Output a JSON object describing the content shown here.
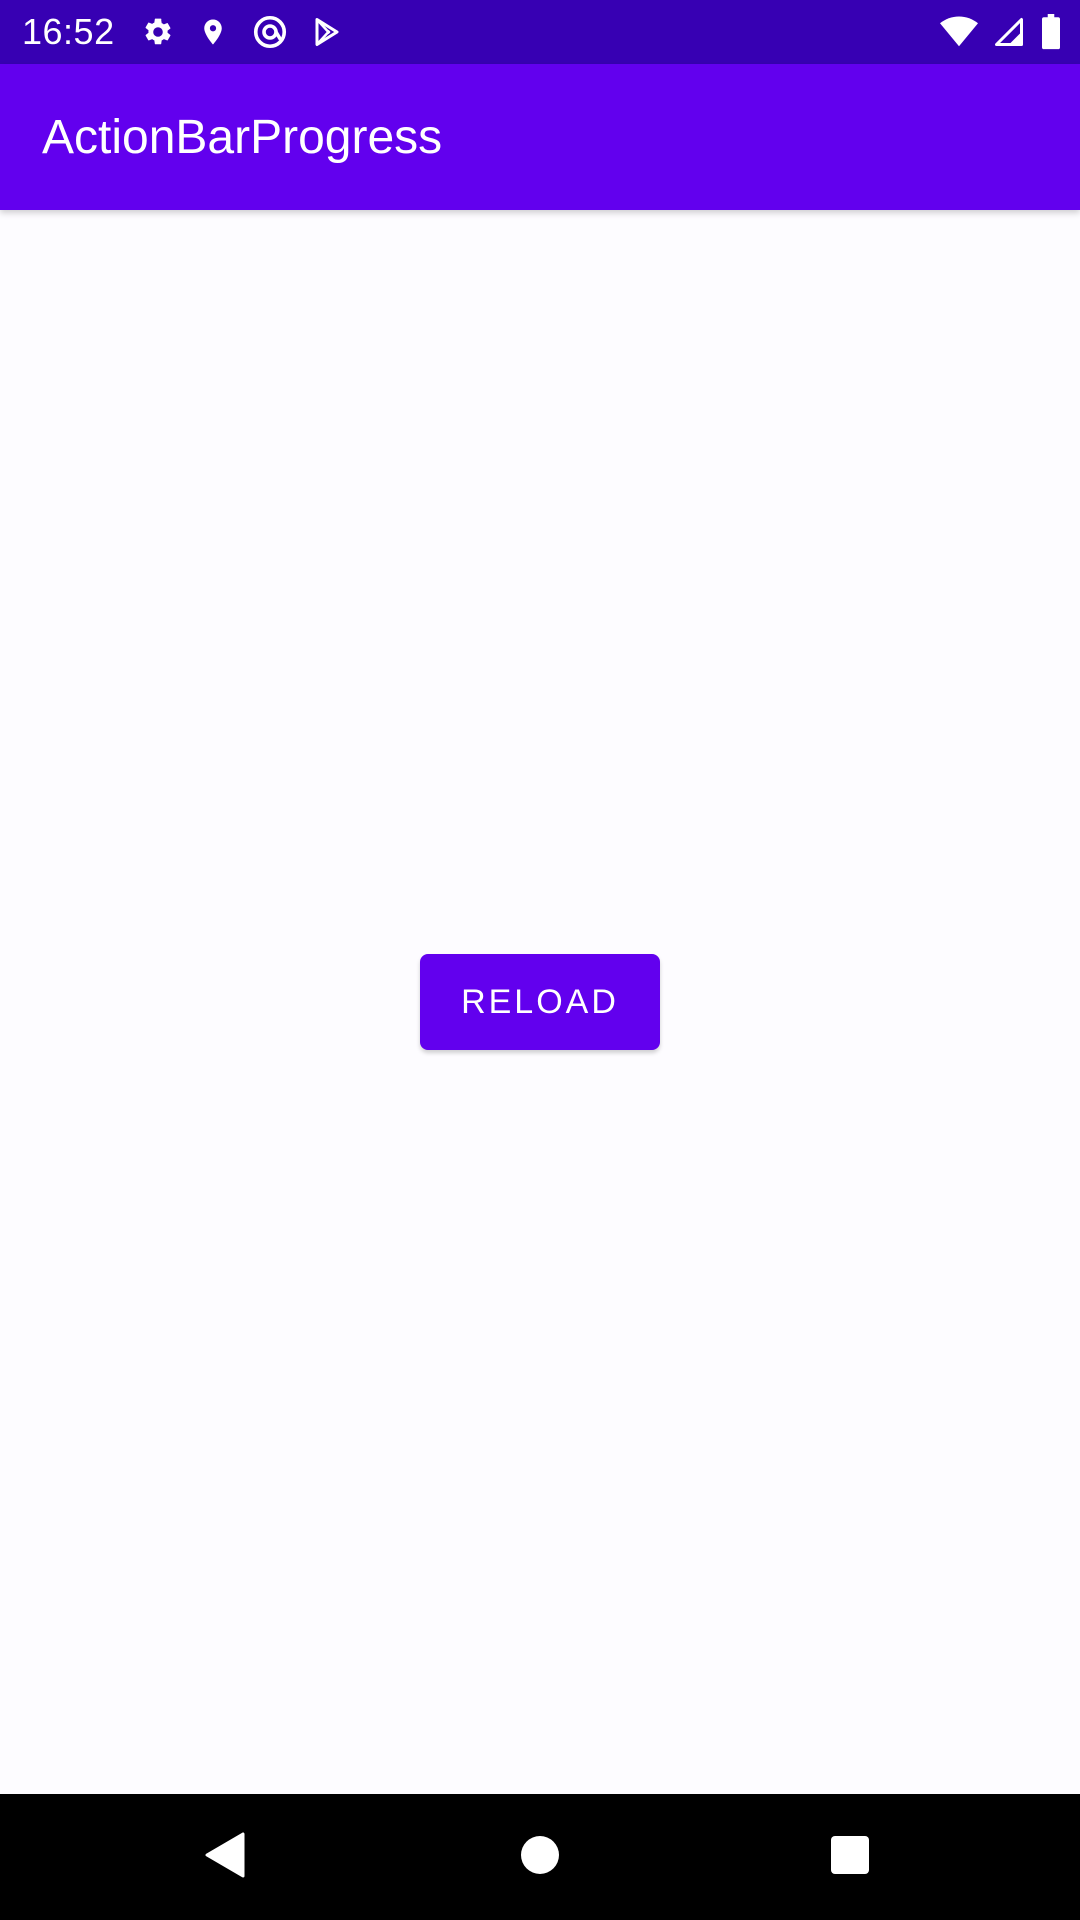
{
  "status_bar": {
    "time": "16:52",
    "left_icons": [
      "settings-icon",
      "location-icon",
      "at-sign-icon",
      "play-store-icon"
    ],
    "right_icons": [
      "wifi-icon",
      "cellular-signal-icon",
      "battery-icon"
    ],
    "background_color": "#3700b3"
  },
  "app_bar": {
    "title": "ActionBarProgress",
    "background_color": "#6200ee"
  },
  "main": {
    "reload_button_label": "RELOAD",
    "button_color": "#6200ee"
  },
  "nav_bar": {
    "buttons": [
      "back-icon",
      "home-icon",
      "recents-icon"
    ]
  }
}
